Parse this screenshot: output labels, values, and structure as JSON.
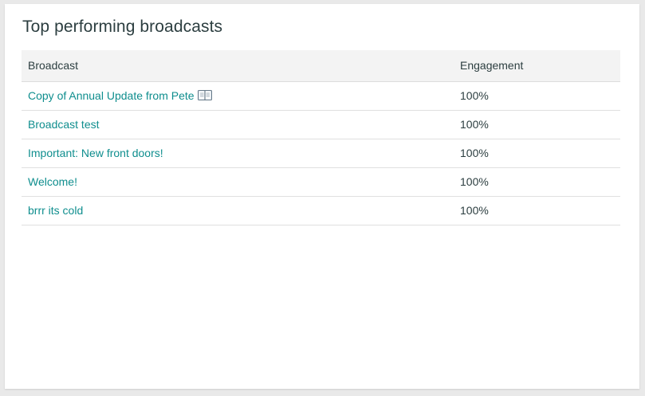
{
  "card": {
    "title": "Top performing broadcasts"
  },
  "table": {
    "headers": {
      "broadcast": "Broadcast",
      "engagement": "Engagement"
    },
    "rows": [
      {
        "broadcast": "Copy of Annual Update from Pete",
        "icon": "book-icon",
        "engagement": "100%"
      },
      {
        "broadcast": "Broadcast test",
        "engagement": "100%"
      },
      {
        "broadcast": "Important: New front doors!",
        "engagement": "100%"
      },
      {
        "broadcast": "Welcome!",
        "engagement": "100%"
      },
      {
        "broadcast": "brrr its cold",
        "engagement": "100%"
      }
    ]
  },
  "colors": {
    "link": "#0f8e8e",
    "text": "#2c3e40",
    "header_bg": "#f3f3f3",
    "page_bg": "#e9e9e9"
  }
}
